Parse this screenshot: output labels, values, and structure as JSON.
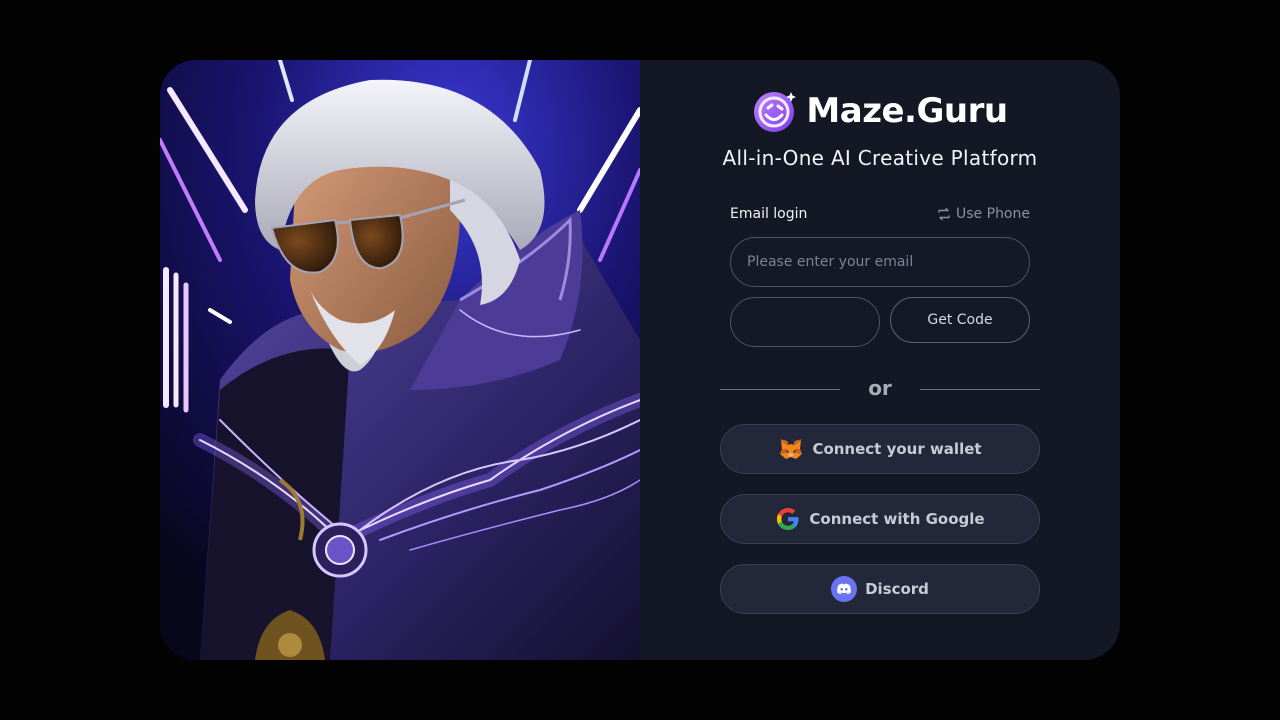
{
  "brand": {
    "name": "Maze.Guru",
    "tagline": "All-in-One AI Creative Platform"
  },
  "login": {
    "title": "Email login",
    "switch_label": "Use Phone",
    "email_placeholder": "Please enter your email",
    "email_value": "",
    "code_value": "",
    "get_code_label": "Get Code"
  },
  "divider": {
    "label": "or"
  },
  "social": {
    "wallet_label": "Connect your wallet",
    "google_label": "Connect with Google",
    "discord_label": "Discord"
  },
  "icons": {
    "brand": "smiley-logo-icon",
    "switch": "swap-icon",
    "wallet": "metamask-fox-icon",
    "google": "google-g-icon",
    "discord": "discord-icon"
  },
  "colors": {
    "background": "#030304",
    "panel": "#141724",
    "button": "#222739",
    "brand_purple": "#8b5cf6",
    "discord_blue": "#5865f2"
  }
}
